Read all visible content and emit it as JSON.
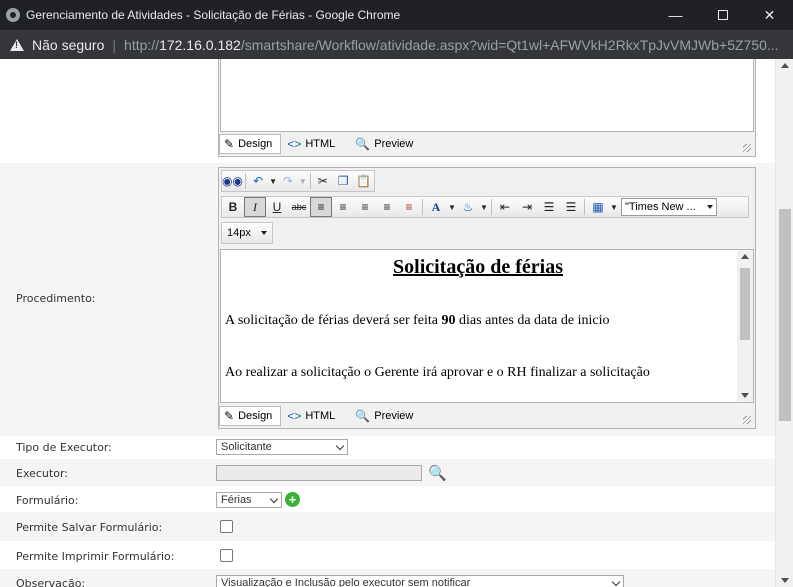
{
  "window": {
    "title": "Gerenciamento de Atividades - Solicitação de Férias - Google Chrome",
    "minimize_icon": "minimize-icon",
    "maximize_icon": "maximize-icon",
    "close_icon": "close-icon"
  },
  "address": {
    "security_label": "Não seguro",
    "url_scheme": "http://",
    "url_host": "172.16.0.182",
    "url_path": "/smartshare/Workflow/atividade.aspx?wid=Qt1wl+AFWVkH2RkxTpJvVMJWb+5Z750..."
  },
  "editor_top": {
    "modes": [
      "Design",
      "HTML",
      "Preview"
    ]
  },
  "procedimento": {
    "label": "Procedimento:",
    "font_name": "\"Times New ...",
    "font_size": "14px",
    "doc_title": "Solicitação de férias",
    "para1_before": "A solicitação de férias deverá ser feita ",
    "para1_bold": "90",
    "para1_after": " dias antes da data de inicio",
    "para2": "Ao realizar a solicitação o Gerente irá aprovar e o RH finalizar a solicitação",
    "modes": [
      "Design",
      "HTML",
      "Preview"
    ]
  },
  "form": {
    "tipo_executor_label": "Tipo de Executor:",
    "tipo_executor_value": "Solicitante",
    "executor_label": "Executor:",
    "formulario_label": "Formulário:",
    "formulario_value": "Férias",
    "permite_salvar_label": "Permite Salvar Formulário:",
    "permite_imprimir_label": "Permite Imprimir Formulário:",
    "observacao_label": "Observação:",
    "observacao_value": "Visualização e Inclusão pelo executor sem notificar"
  },
  "colors": {
    "titlebar": "#202124",
    "addressbar": "#35363a",
    "row_alt": "#f5f5f5",
    "add_green": "#3cb034"
  }
}
